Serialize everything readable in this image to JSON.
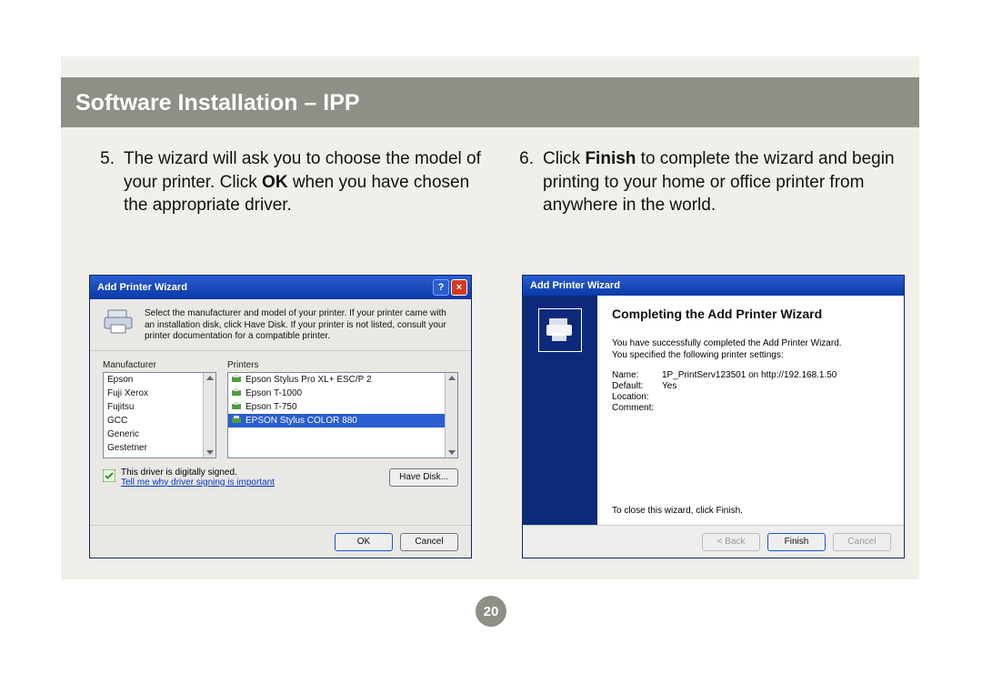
{
  "header": {
    "title": "Software Installation – IPP"
  },
  "steps": {
    "s5_num": "5.",
    "s5_pre": "The wizard will ask you to choose the model of your printer.  Click ",
    "s5_bold": "OK",
    "s5_post": " when you have chosen the appropriate driver.",
    "s6_num": "6.",
    "s6_pre": "Click ",
    "s6_bold": "Finish",
    "s6_post": " to complete the wizard and begin printing to your home or office printer from anywhere in the world."
  },
  "dlgA": {
    "title": "Add Printer Wizard",
    "intro": "Select the manufacturer and model of your printer. If your printer came with an installation disk, click Have Disk. If your printer is not listed, consult your printer documentation for a compatible printer.",
    "mfr_label": "Manufacturer",
    "prn_label": "Printers",
    "mfrs": [
      "Epson",
      "Fuji Xerox",
      "Fujitsu",
      "GCC",
      "Generic",
      "Gestetner"
    ],
    "prns": [
      "Epson Stylus Pro XL+ ESC/P 2",
      "Epson T-1000",
      "Epson T-750",
      "EPSON Stylus COLOR 880"
    ],
    "prn_selected_index": 3,
    "signed_text": "This driver is digitally signed.",
    "signed_link": "Tell me why driver signing is important",
    "have_disk": "Have Disk...",
    "ok": "OK",
    "cancel": "Cancel"
  },
  "dlgB": {
    "title": "Add Printer Wizard",
    "heading": "Completing the Add Printer Wizard",
    "msg1": "You have successfully completed the Add Printer Wizard.",
    "msg2": "You specified the following printer settings:",
    "props": [
      {
        "n": "Name:",
        "v": "1P_PrintServ123501 on http://192.168.1.50"
      },
      {
        "n": "Default:",
        "v": "Yes"
      },
      {
        "n": "Location:",
        "v": ""
      },
      {
        "n": "Comment:",
        "v": ""
      }
    ],
    "close_text": "To close this wizard, click Finish.",
    "back": "< Back",
    "finish": "Finish",
    "cancel": "Cancel"
  },
  "page_number": "20"
}
